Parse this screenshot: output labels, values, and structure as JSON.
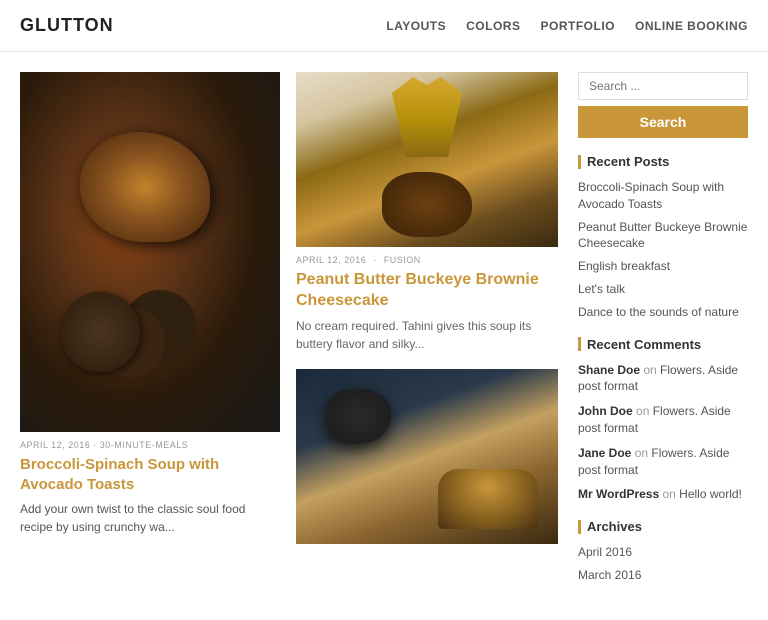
{
  "header": {
    "logo": "GLUTTON",
    "nav": [
      {
        "label": "LAYOUTS",
        "href": "#"
      },
      {
        "label": "COLORS",
        "href": "#"
      },
      {
        "label": "PORTFOLIO",
        "href": "#"
      },
      {
        "label": "ONLINE BOOKING",
        "href": "#"
      }
    ]
  },
  "featured_post": {
    "meta": "APRIL 12, 2016 · 30-MINUTE-MEALS",
    "title": "Broccoli-Spinach Soup with Avocado Toasts",
    "excerpt": "Add your own twist to the classic soul food recipe by using crunchy wa..."
  },
  "posts": [
    {
      "meta_date": "APRIL 12, 2016",
      "meta_category": "FUSION",
      "title": "Peanut Butter Buckeye Brownie Cheesecake",
      "excerpt": "No cream required. Tahini gives this soup its buttery flavor and silky..."
    }
  ],
  "sidebar": {
    "search_placeholder": "Search ...",
    "search_button": "Search",
    "recent_posts_title": "Recent Posts",
    "recent_posts": [
      "Broccoli-Spinach Soup with Avocado Toasts",
      "Peanut Butter Buckeye Brownie Cheesecake",
      "English breakfast",
      "Let's talk",
      "Dance to the sounds of nature"
    ],
    "recent_comments_title": "Recent Comments",
    "recent_comments": [
      {
        "author": "Shane Doe",
        "on": "on",
        "post": "Flowers. Aside post format"
      },
      {
        "author": "John Doe",
        "on": "on",
        "post": "Flowers. Aside post format"
      },
      {
        "author": "Jane Doe",
        "on": "on",
        "post": "Flowers. Aside post format"
      },
      {
        "author": "Mr WordPress",
        "on": "on",
        "post": "Hello world!"
      }
    ],
    "archives_title": "Archives",
    "archives": [
      "April 2016",
      "March 2016"
    ]
  }
}
